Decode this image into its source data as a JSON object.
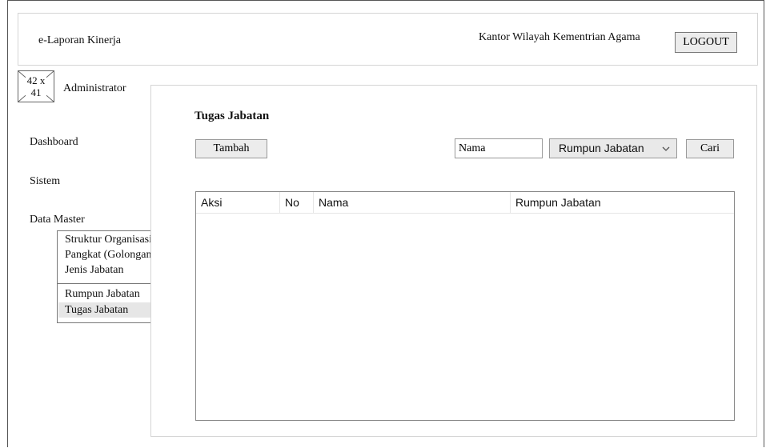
{
  "header": {
    "app_title": "e-Laporan Kinerja",
    "office": "Kantor Wilayah Kementrian Agama",
    "logout_label": "LOGOUT"
  },
  "user": {
    "avatar_placeholder": "42 x 41",
    "name": "Administrator"
  },
  "sidebar": {
    "items": [
      {
        "label": "Dashboard"
      },
      {
        "label": "Sistem"
      },
      {
        "label": "Data Master"
      }
    ],
    "data_master_menu": [
      {
        "label": "Struktur Organisasi"
      },
      {
        "label": "Pangkat (Golongan)"
      },
      {
        "label": "Jenis Jabatan"
      },
      {
        "label": "Rumpun Jabatan"
      },
      {
        "label": "Tugas Jabatan",
        "active": true
      }
    ]
  },
  "main": {
    "title": "Tugas Jabatan",
    "add_button": "Tambah",
    "search": {
      "name_value": "Nama",
      "filter_selected": "Rumpun Jabatan",
      "search_button": "Cari"
    },
    "table": {
      "columns": [
        "Aksi",
        "No",
        "Nama",
        "Rumpun Jabatan"
      ],
      "rows": []
    }
  }
}
